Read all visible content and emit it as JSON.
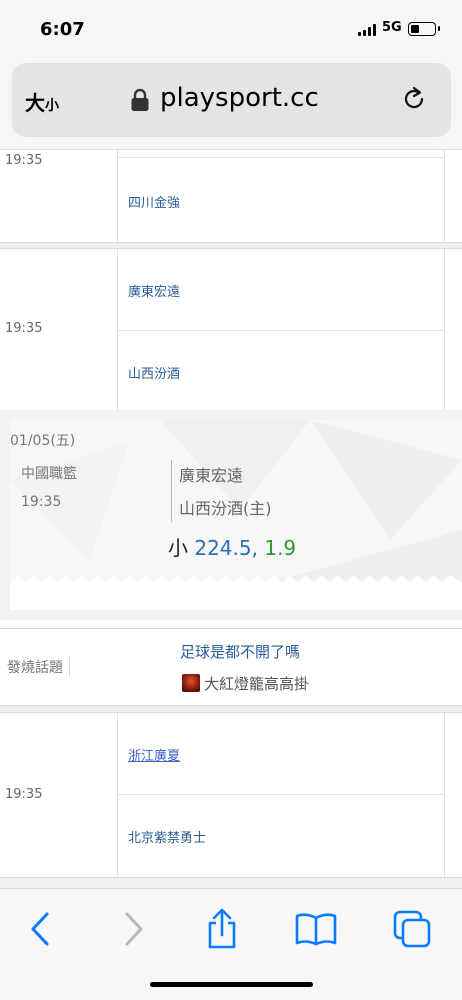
{
  "status_bar": {
    "time": "6:07",
    "network": "5G"
  },
  "url_bar": {
    "text_size_label": "大",
    "text_size_small": "小",
    "domain": "playsport.cc"
  },
  "games": [
    {
      "time": "19:35",
      "teams": [
        "四川金強"
      ]
    },
    {
      "time": "19:35",
      "teams": [
        "廣東宏遠",
        "山西汾酒"
      ]
    },
    {
      "time": "19:35",
      "teams": [
        "浙江廣夏",
        "北京紫禁勇士"
      ]
    }
  ],
  "prediction_card": {
    "date": "01/05(五)",
    "league": "中國職籃",
    "time": "19:35",
    "home": "廣東宏遠",
    "away": "山西汾酒(主)",
    "pick": "小",
    "line": "224.5,",
    "odds": "1.9"
  },
  "hot_topic": {
    "label": "發燒話題",
    "title": "足球是都不開了嗎",
    "author": "大紅燈籠高高掛"
  },
  "colors": {
    "link": "#2a5d9a",
    "line_blue": "#2d6db5",
    "odds_green": "#2f9a2f",
    "ios_blue": "#0a7aff"
  }
}
